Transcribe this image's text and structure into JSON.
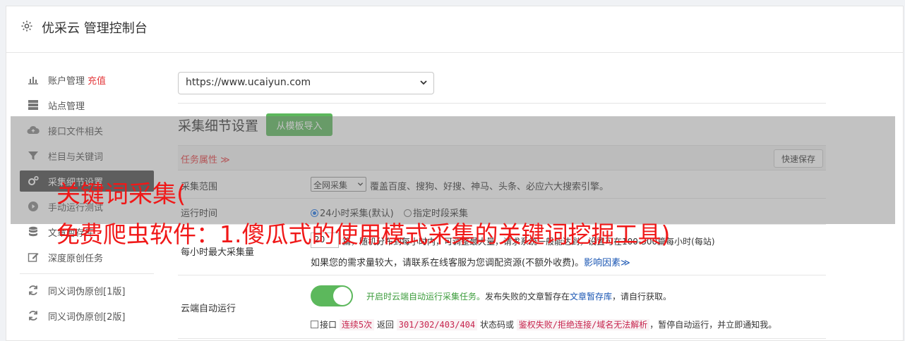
{
  "header": {
    "title": "优采云 管理控制台",
    "icon": "gear-icon"
  },
  "sidebar": {
    "items": [
      {
        "label": "账户管理",
        "extra": "充值",
        "icon": "bar-chart-icon"
      },
      {
        "label": "站点管理",
        "icon": "server-icon"
      },
      {
        "label": "接口文件相关",
        "icon": "cloud-upload-icon"
      },
      {
        "label": "栏目与关键词",
        "icon": "filter-icon"
      },
      {
        "label": "采集细节设置",
        "icon": "cogs-icon",
        "active": true
      },
      {
        "label": "手动运行测试",
        "icon": "play-circle-icon"
      },
      {
        "label": "文章暂存库",
        "icon": "database-icon"
      },
      {
        "label": "深度原创任务",
        "icon": "edit-icon"
      }
    ],
    "items2": [
      {
        "label": "同义词伪原创[1版]",
        "icon": "refresh-icon"
      },
      {
        "label": "同义词伪原创[2版]",
        "icon": "refresh-icon"
      }
    ]
  },
  "main": {
    "site_select": "https://www.ucaiyun.com",
    "section_title": "采集细节设置",
    "import_button": "从模板导入",
    "task_attr_label": "任务属性 ≫",
    "quick_save": "快速保存",
    "rows": {
      "scope": {
        "label": "采集范围",
        "select_value": "全网采集",
        "desc": "覆盖百度、搜狗、好搜、神马、头条、必应六大搜索引擎。"
      },
      "runtime": {
        "label": "运行时间",
        "option1": "24小时采集(默认)",
        "option2": "指定时段采集"
      },
      "max_per_hour": {
        "label": "每小时最大采集量",
        "input_value": "20",
        "desc": "篇，随机分布到每小时内，可调整最大量，请求系统一般能达到，设置可在100-300篇每小时(每站)",
        "desc2": "如果您的需求量较大，请联系在线客服为您调配资源(不额外收费)。",
        "link": "影响因素≫"
      },
      "cloud_auto": {
        "label": "云端自动运行",
        "toggle_on": true,
        "desc_green": "开启时云端自动运行采集任务。",
        "desc_mid": "发布失败的文章暂存在",
        "desc_link": "文章暂存库",
        "desc_end": "，请自行获取。",
        "check_prefix": "接口",
        "code1": "连续5次",
        "mid1": "返回",
        "code2": "301/302/403/404",
        "mid2": "状态码或",
        "code3": "鉴权失败/拒绝连接/域名无法解析",
        "tail": "，暂停自动运行，并立即通知我。"
      }
    }
  },
  "overlay": {
    "line1": "关键词采集(",
    "line2": "免费爬虫软件：1.傻瓜式的使用模式采集的关键词挖掘工具)"
  },
  "colors": {
    "accent_green": "#5cb85c",
    "danger_red": "#e4393c",
    "overlay_text": "#f01818"
  }
}
